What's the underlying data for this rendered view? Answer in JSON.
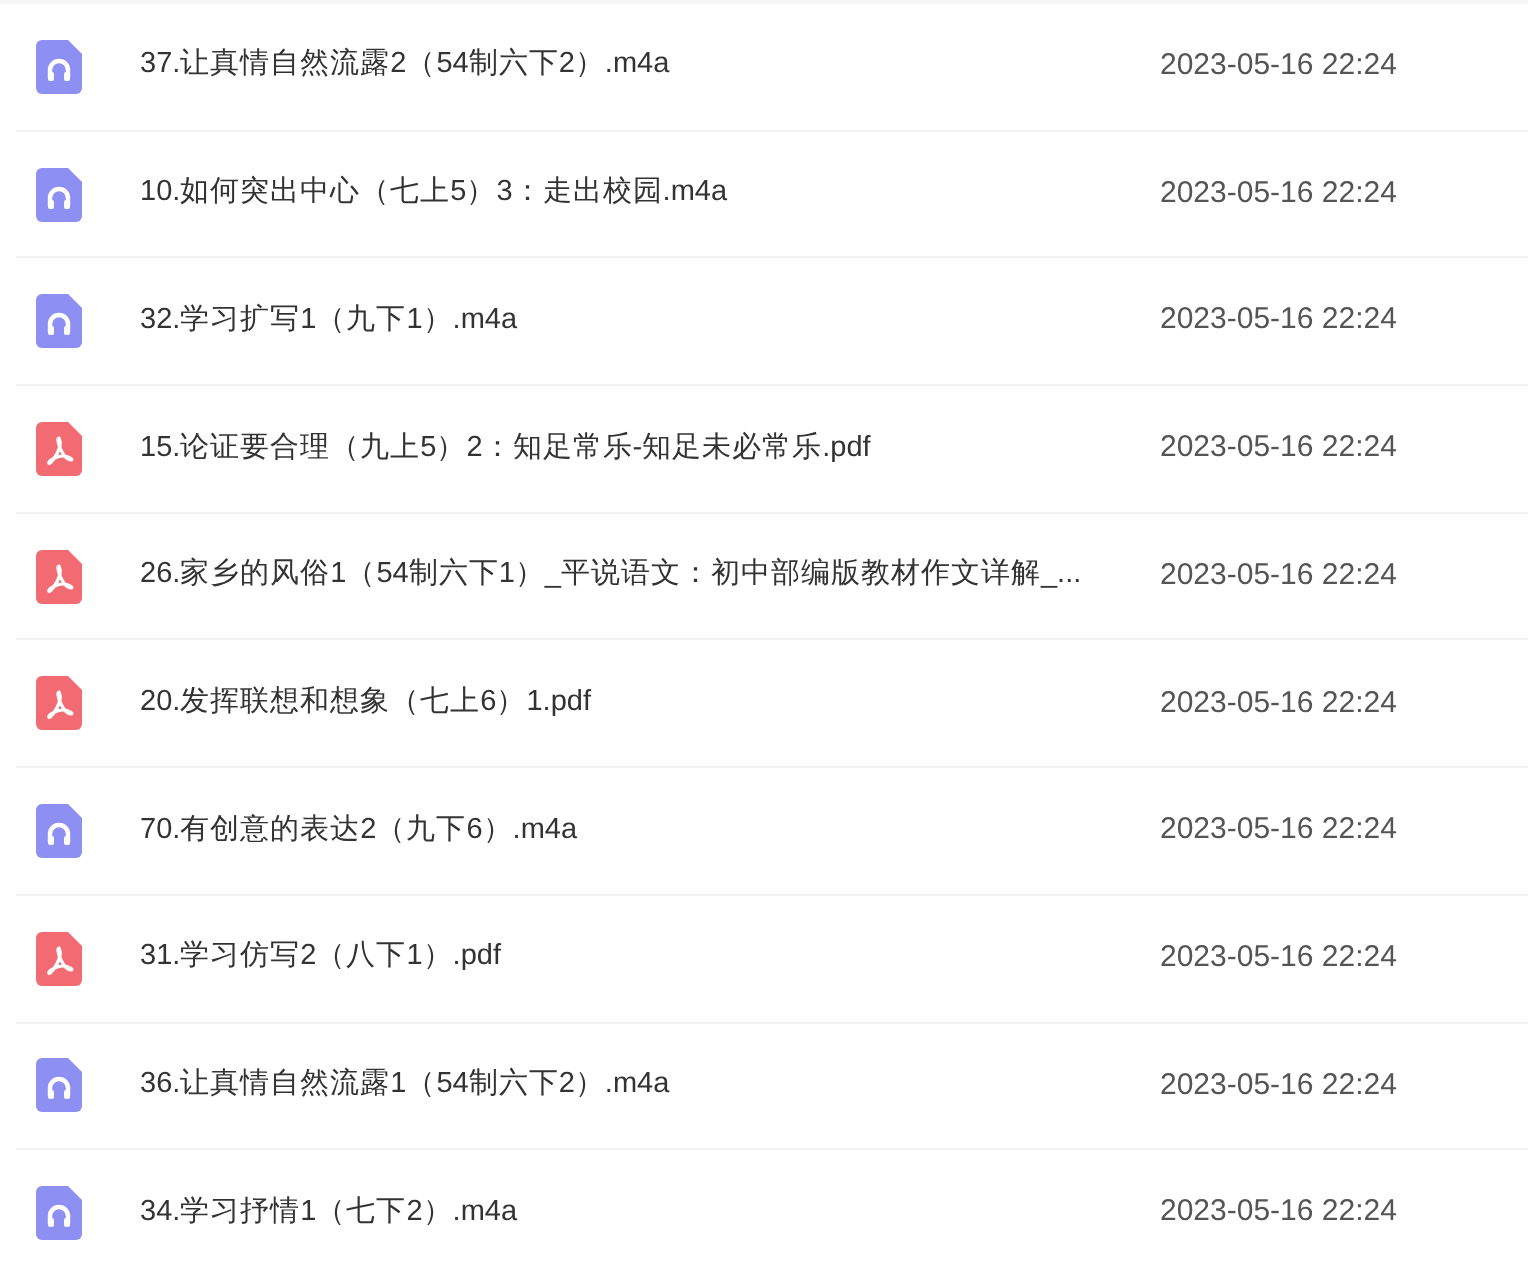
{
  "files": [
    {
      "kind": "audio",
      "name": "37.让真情自然流露2（54制六下2）.m4a",
      "date": "2023-05-16 22:24"
    },
    {
      "kind": "audio",
      "name": "10.如何突出中心（七上5）3：走出校园.m4a",
      "date": "2023-05-16 22:24"
    },
    {
      "kind": "audio",
      "name": "32.学习扩写1（九下1）.m4a",
      "date": "2023-05-16 22:24"
    },
    {
      "kind": "pdf",
      "name": "15.论证要合理（九上5）2：知足常乐-知足未必常乐.pdf",
      "date": "2023-05-16 22:24"
    },
    {
      "kind": "pdf",
      "name": "26.家乡的风俗1（54制六下1）_平说语文：初中部编版教材作文详解_...",
      "date": "2023-05-16 22:24"
    },
    {
      "kind": "pdf",
      "name": "20.发挥联想和想象（七上6）1.pdf",
      "date": "2023-05-16 22:24"
    },
    {
      "kind": "audio",
      "name": "70.有创意的表达2（九下6）.m4a",
      "date": "2023-05-16 22:24"
    },
    {
      "kind": "pdf",
      "name": "31.学习仿写2（八下1）.pdf",
      "date": "2023-05-16 22:24"
    },
    {
      "kind": "audio",
      "name": "36.让真情自然流露1（54制六下2）.m4a",
      "date": "2023-05-16 22:24"
    },
    {
      "kind": "audio",
      "name": "34.学习抒情1（七下2）.m4a",
      "date": "2023-05-16 22:24"
    }
  ]
}
